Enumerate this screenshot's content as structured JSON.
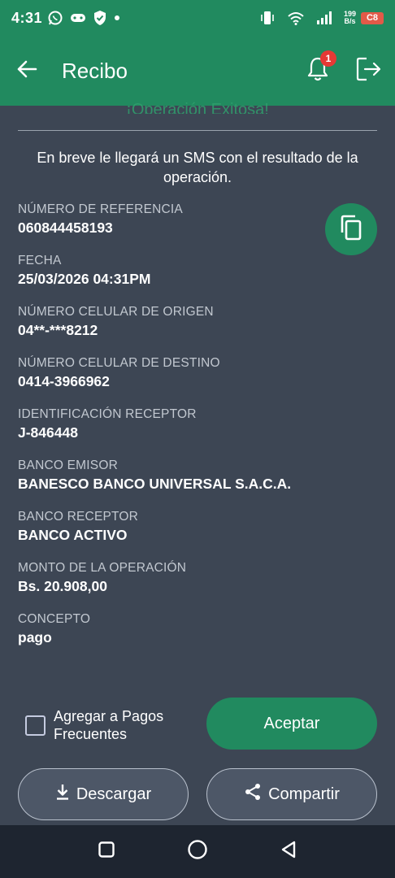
{
  "status_bar": {
    "time": "4:31",
    "net_speed_value": "199",
    "net_speed_unit": "B/s",
    "battery": "C8",
    "icons": [
      "whatsapp-icon",
      "gamepad-icon",
      "shield-check-icon",
      "dot-icon",
      "vibrate-icon",
      "wifi-icon",
      "signal-icon",
      "battery-icon"
    ]
  },
  "app_bar": {
    "title": "Recibo",
    "notification_count": "1",
    "icons": [
      "back-arrow-icon",
      "bell-icon",
      "logout-icon"
    ]
  },
  "receipt": {
    "success_title": "¡Operación Exitosa!",
    "sms_message": "En breve le llegará un SMS con el resultado de la operación.",
    "fields": [
      {
        "label": "NÚMERO DE REFERENCIA",
        "value": "060844458193"
      },
      {
        "label": "FECHA",
        "value": "25/03/2026 04:31PM"
      },
      {
        "label": "NÚMERO CELULAR DE ORIGEN",
        "value": "04**-***8212"
      },
      {
        "label": "NÚMERO CELULAR DE DESTINO",
        "value": "0414-3966962"
      },
      {
        "label": "IDENTIFICACIÓN RECEPTOR",
        "value": "J-846448"
      },
      {
        "label": "BANCO EMISOR",
        "value": "BANESCO BANCO UNIVERSAL S.A.C.A."
      },
      {
        "label": "BANCO RECEPTOR",
        "value": "BANCO ACTIVO"
      },
      {
        "label": "MONTO DE LA OPERACIÓN",
        "value": "Bs. 20.908,00"
      },
      {
        "label": "CONCEPTO",
        "value": "pago"
      }
    ]
  },
  "actions": {
    "frequent_label": "Agregar a Pagos Frecuentes",
    "frequent_checked": false,
    "accept_label": "Aceptar",
    "download_label": "Descargar",
    "share_label": "Compartir"
  },
  "colors": {
    "primary_green": "#218a5f",
    "background": "#3d4654",
    "badge_red": "#e53935"
  }
}
